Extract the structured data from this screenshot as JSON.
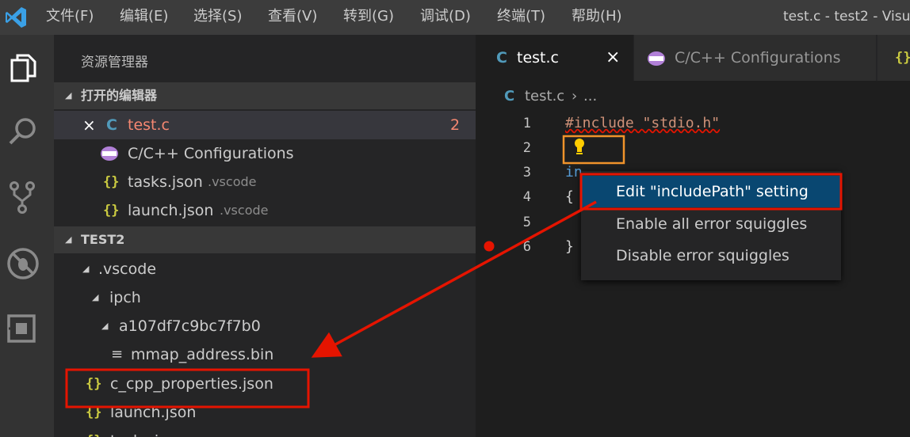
{
  "menu": {
    "items": [
      "文件(F)",
      "编辑(E)",
      "选择(S)",
      "查看(V)",
      "转到(G)",
      "调试(D)",
      "终端(T)",
      "帮助(H)"
    ]
  },
  "window": {
    "title": "test.c - test2 - Visu"
  },
  "activity": {
    "icons": [
      "files-icon",
      "search-icon",
      "source-control-icon",
      "debug-icon",
      "extensions-icon"
    ]
  },
  "sidebar": {
    "title": "资源管理器",
    "open_editors": {
      "header": "打开的编辑器",
      "items": [
        {
          "close": "×",
          "icon": "C",
          "label": "test.c",
          "badge": "2"
        },
        {
          "icon": "C/C++",
          "label": "C/C++ Configurations"
        },
        {
          "icon": "{}",
          "label": "tasks.json",
          "desc": ".vscode"
        },
        {
          "icon": "{}",
          "label": "launch.json",
          "desc": ".vscode"
        }
      ]
    },
    "workspace": {
      "header": "TEST2",
      "items": [
        {
          "label": ".vscode"
        },
        {
          "label": "ipch"
        },
        {
          "label": "a107df7c9bc7f7b0"
        },
        {
          "icon": "≡",
          "label": "mmap_address.bin"
        },
        {
          "icon": "{}",
          "label": "c_cpp_properties.json"
        },
        {
          "icon": "{}",
          "label": "launch.json"
        },
        {
          "icon": "{}",
          "label": "tasks.js"
        }
      ]
    }
  },
  "editor": {
    "tabs": [
      {
        "icon": "C",
        "label": "test.c",
        "close": "×"
      },
      {
        "icon": "C/C++",
        "label": "C/C++ Configurations"
      },
      {
        "icon": "{}",
        "label": ""
      }
    ],
    "breadcrumb": {
      "icon": "C",
      "file": "test.c",
      "sep": "›",
      "more": "..."
    },
    "lines": [
      {
        "num": "1",
        "text": "#include \"stdio.h\""
      },
      {
        "num": "2",
        "text": ""
      },
      {
        "num": "3",
        "text": "in"
      },
      {
        "num": "4",
        "text": "{"
      },
      {
        "num": "5",
        "text": ""
      },
      {
        "num": "6",
        "text": "}"
      }
    ]
  },
  "context_menu": {
    "items": [
      "Edit \"includePath\" setting",
      "Enable all error squiggles",
      "Disable error squiggles"
    ]
  },
  "colors": {
    "annotation_red": "#e51400",
    "lightbulb_box": "#f0932b",
    "selection": "#094771",
    "accent_blue": "#519aba",
    "json_yellow": "#cbcb41"
  }
}
